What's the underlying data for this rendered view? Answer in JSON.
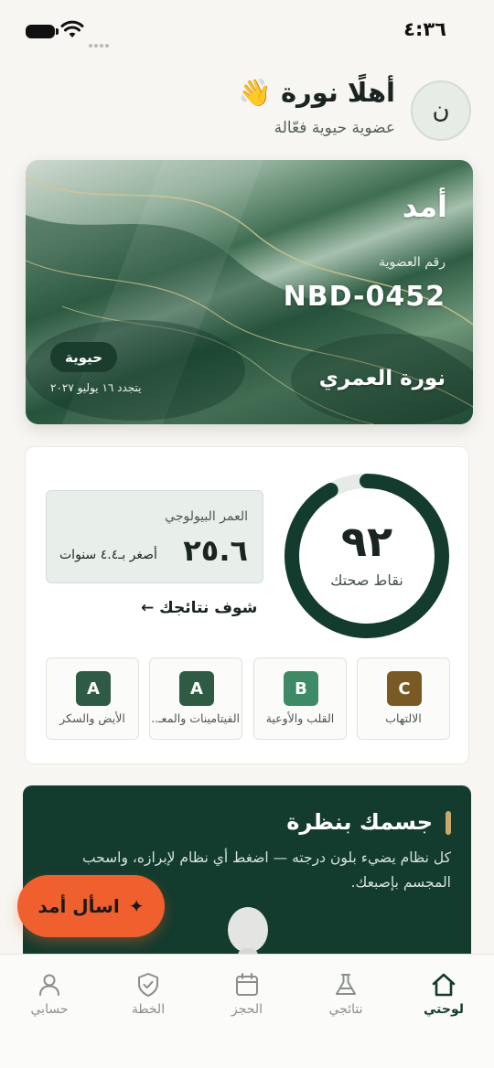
{
  "status_bar": {
    "time": "٤:٣٦"
  },
  "header": {
    "avatar_initial": "ن",
    "greeting": "أهلًا نورة 👋",
    "subtitle": "عضوية حيوية فعّالة"
  },
  "membership_card": {
    "brand": "أمد",
    "number_label": "رقم العضوية",
    "number": "NBD-0452",
    "holder": "نورة العمري",
    "tier": "حيوية",
    "renewal": "يتجدد ١٦ يوليو ٢٠٢٧"
  },
  "health": {
    "score": "٩٢",
    "score_value": 92,
    "score_max": 100,
    "score_label": "نقاط صحتك",
    "bio_age_title": "العمر البيولوجي",
    "bio_age_value": "٢٥.٦",
    "bio_age_note": "أصغر بـ٤.٤ سنوات",
    "results_link": "شوف نتائجك ←",
    "tiles": [
      {
        "grade": "C",
        "label": "الالتهاب",
        "color": "#7a5a24"
      },
      {
        "grade": "B",
        "label": "القلب والأوعية",
        "color": "#3f8a66"
      },
      {
        "grade": "A",
        "label": "الفيتامينات والمعـ...",
        "color": "#2f5a43"
      },
      {
        "grade": "A",
        "label": "الأيض والسكر",
        "color": "#2f5a43"
      }
    ]
  },
  "body_map": {
    "title": "جسمك بنظرة",
    "description": "كل نظام يضيء بلون درجته — اضغط أي نظام لإبرازه، واسحب المجسم بإصبعك."
  },
  "fab": {
    "label": "اسأل أمد",
    "icon": "sparkle-icon"
  },
  "nav": {
    "items": [
      {
        "label": "لوحتي",
        "icon": "home-icon",
        "active": true
      },
      {
        "label": "نتائجي",
        "icon": "flask-icon",
        "active": false
      },
      {
        "label": "الحجز",
        "icon": "calendar-icon",
        "active": false
      },
      {
        "label": "الخطة",
        "icon": "shield-check-icon",
        "active": false
      },
      {
        "label": "حسابي",
        "icon": "user-icon",
        "active": false
      }
    ]
  },
  "colors": {
    "primary": "#133b2e",
    "accent": "#f0602e",
    "gold": "#c9a86a",
    "background": "#f7f6f2"
  }
}
